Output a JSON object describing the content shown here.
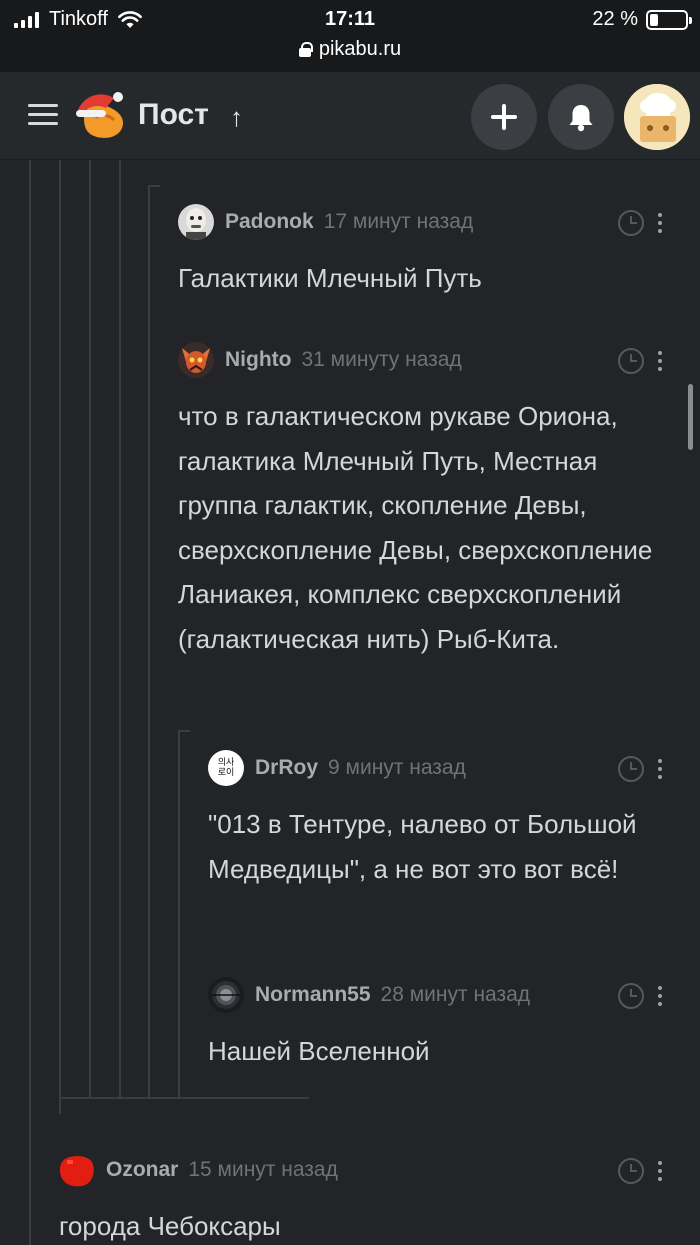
{
  "status_bar": {
    "carrier": "Tinkoff",
    "time": "17:11",
    "battery": "22 %",
    "battery_level": 0.22,
    "url": "pikabu.ru"
  },
  "header": {
    "title": "Пост",
    "up_arrow": "↑",
    "icons": [
      "menu-icon",
      "pikabu-logo",
      "plus-icon",
      "bell-icon",
      "avatar"
    ]
  },
  "colors": {
    "background": "#222427",
    "header": "#26292c",
    "status_bar": "#17191b",
    "username": "#a8abaf",
    "timestamp": "#6f7377"
  },
  "comments": [
    {
      "user": "Padonok",
      "time": "17 минут назад",
      "text": "Галактики Млечный Путь"
    },
    {
      "user": "Nighto",
      "time": "31 минуту назад",
      "text": "что в галактическом рукаве Ориона, галактика Млечный Путь, Местная группа галактик, скопление Девы, сверхскопление Девы, сверхскопление Ланиакея, комплекс сверхскоплений (галактическая нить) Рыб-Кита."
    },
    {
      "user": "DrRoy",
      "time": "9 минут назад",
      "text": "\"013 в Тентуре, налево от Большой Медведицы\", а не вот это вот всё!",
      "avatar_text": "의사 로이"
    },
    {
      "user": "Normann55",
      "time": "28 минут назад",
      "text": "Нашей Вселенной"
    },
    {
      "user": "Ozonar",
      "time": "15 минут назад",
      "text": "города Чебоксары"
    }
  ]
}
